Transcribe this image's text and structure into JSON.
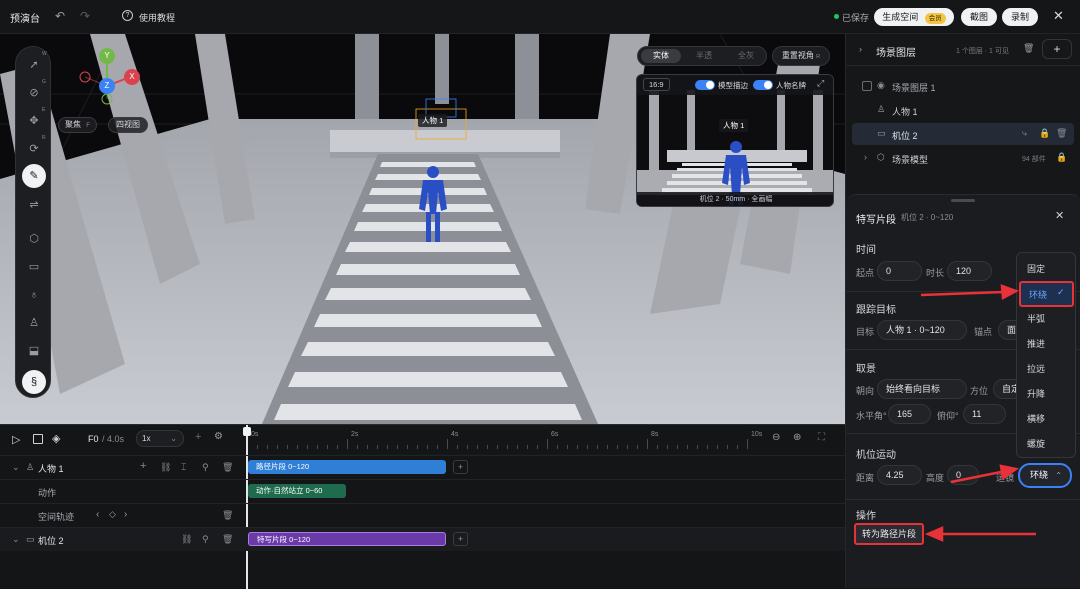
{
  "topbar": {
    "title": "预演台",
    "tutorial": "使用教程",
    "saved": "已保存",
    "generate": "生成空间",
    "vip": "会员",
    "screenshot": "截图",
    "record": "录制"
  },
  "viewport": {
    "gizmo": {
      "y": "Y",
      "z": "Z",
      "x": "X"
    },
    "focus": "聚焦",
    "focus_key": "F",
    "four_view": "四视图",
    "render_modes": [
      "实体",
      "半透",
      "全灰"
    ],
    "reset_view": "重置视角",
    "reset_key": "R",
    "person_label": "人物 1",
    "tool_keys": [
      "W",
      "G",
      "E",
      "R"
    ],
    "preview": {
      "ratio": "16:9",
      "toggle1": "模型描边",
      "toggle2": "人物名牌",
      "person_label": "人物 1",
      "caption": "机位 2 · 50mm · 全画幅"
    }
  },
  "timeline": {
    "frame": "F0",
    "duration": "/ 4.0s",
    "speed": "1x",
    "ticks": [
      "0s",
      "2s",
      "4s",
      "6s",
      "8s",
      "10s"
    ],
    "tracks": {
      "person": "人物 1",
      "action": "动作",
      "trajectory": "空间轨迹",
      "camera": "机位 2"
    },
    "clips": {
      "path": "路径片段 0~120",
      "action": "动作·自然站立 0~60",
      "closeup": "特写片段 0~120"
    }
  },
  "layers": {
    "title": "场景图层",
    "summary": "1 个图层 · 1 可见",
    "items": [
      {
        "label": "场景图层 1"
      },
      {
        "label": "人物 1"
      },
      {
        "label": "机位 2"
      },
      {
        "label": "场景模型",
        "meta": "94 部件"
      }
    ]
  },
  "props": {
    "title": "特写片段",
    "subtitle": "机位 2 · 0~120",
    "time": {
      "section": "时间",
      "start_label": "起点",
      "start": "0",
      "duration_label": "时长",
      "duration": "120"
    },
    "tracking": {
      "section": "跟踪目标",
      "target_label": "目标",
      "target": "人物 1 · 0~120",
      "anchor_label": "锚点",
      "anchor": "面部"
    },
    "framing": {
      "section": "取景",
      "facing_label": "朝向",
      "facing": "始终看向目标",
      "azimuth_label": "方位",
      "azimuth": "自定",
      "hangle_label": "水平角°",
      "hangle": "165",
      "tilt_label": "俯仰°",
      "tilt": "11"
    },
    "motion": {
      "section": "机位运动",
      "dist_label": "距离",
      "dist": "4.25",
      "height_label": "高度",
      "height": "0",
      "mode_label": "运镜",
      "mode": "环绕"
    },
    "ops": {
      "section": "操作",
      "convert": "转为路径片段"
    }
  },
  "dropdown": {
    "options": [
      "固定",
      "环绕",
      "半弧",
      "推进",
      "拉远",
      "升降",
      "横移",
      "螺旋"
    ],
    "selected": "环绕"
  },
  "colors": {
    "accent": "#3b82f6",
    "highlight": "#e8323a",
    "path_clip": "#2f7fd6",
    "action_clip": "#1f6b4e",
    "closeup_clip": "#6a3aa8"
  }
}
